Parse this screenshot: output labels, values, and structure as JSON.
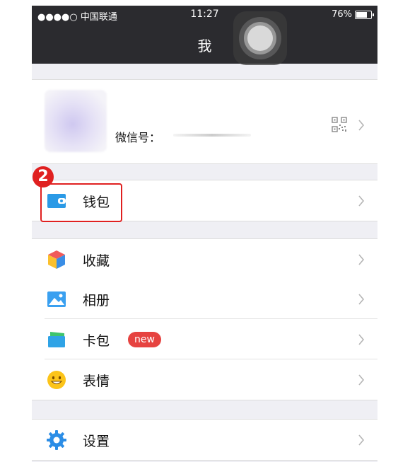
{
  "status_bar": {
    "carrier": "●●●●○ 中国联通",
    "time": "11:27",
    "battery_percent": "76%",
    "battery_level": 0.76
  },
  "nav": {
    "title": "我"
  },
  "profile": {
    "wechat_id_label": "微信号："
  },
  "annotation": {
    "step_number": "2"
  },
  "menu": {
    "wallet": {
      "label": "钱包"
    },
    "favorites": {
      "label": "收藏"
    },
    "album": {
      "label": "相册"
    },
    "cards": {
      "label": "卡包",
      "badge": "new"
    },
    "stickers": {
      "label": "表情"
    },
    "settings": {
      "label": "设置"
    }
  },
  "colors": {
    "nav_bg": "#2b2b2f",
    "page_bg": "#efeff4",
    "accent_red": "#e02020",
    "badge_red": "#e64340",
    "wallet_blue": "#2b9ae6"
  }
}
